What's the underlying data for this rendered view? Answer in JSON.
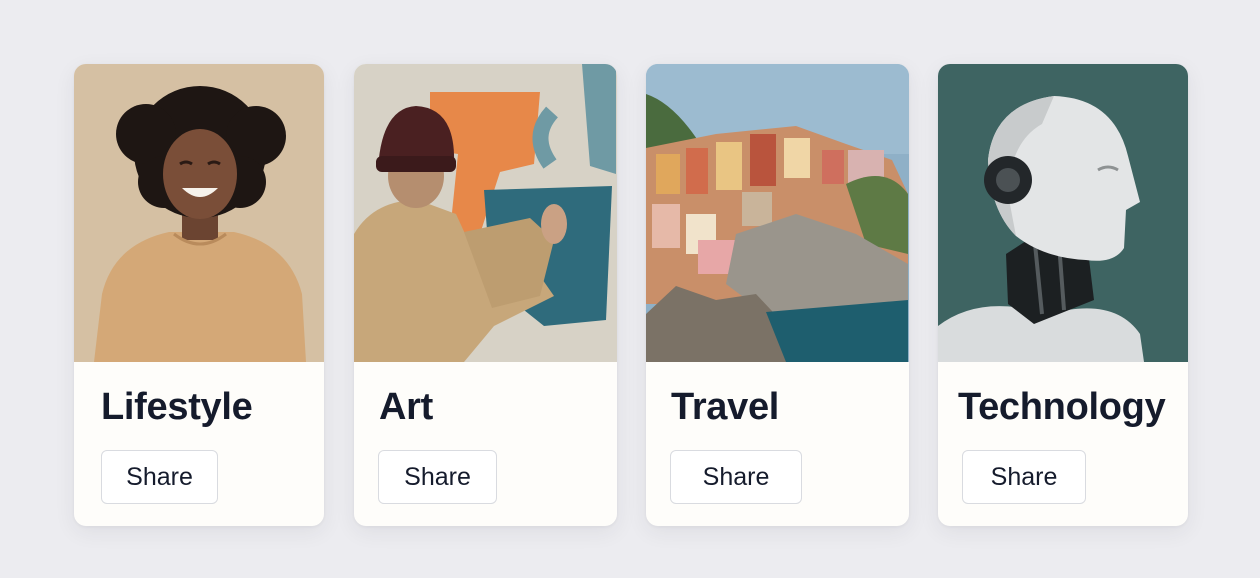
{
  "cards": [
    {
      "id": "lifestyle",
      "title": "Lifestyle",
      "share_label": "Share",
      "image": "smiling-woman-photo"
    },
    {
      "id": "art",
      "title": "Art",
      "share_label": "Share",
      "image": "man-painting-wall-photo"
    },
    {
      "id": "travel",
      "title": "Travel",
      "share_label": "Share",
      "image": "cliffside-village-photo"
    },
    {
      "id": "technology",
      "title": "Technology",
      "share_label": "Share",
      "image": "humanoid-robot-photo"
    }
  ],
  "colors": {
    "page_background": "#ececf0",
    "card_background": "#fefdfa",
    "title_text": "#151b2c",
    "button_border": "#d9dbe0"
  }
}
